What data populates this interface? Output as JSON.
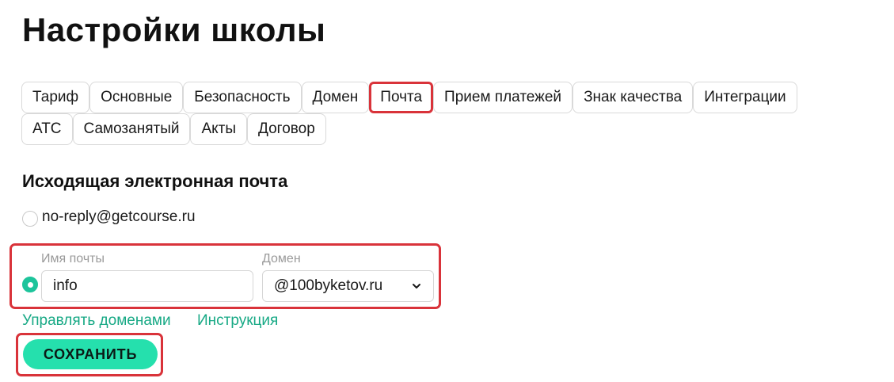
{
  "page": {
    "title": "Настройки школы"
  },
  "tabs": {
    "row1": [
      {
        "label": "Тариф"
      },
      {
        "label": "Основные"
      },
      {
        "label": "Безопасность"
      },
      {
        "label": "Домен"
      },
      {
        "label": "Почта",
        "active": true
      },
      {
        "label": "Прием платежей"
      },
      {
        "label": "Знак качества"
      },
      {
        "label": "Интеграции"
      }
    ],
    "row2": [
      {
        "label": "АТС"
      },
      {
        "label": "Самозанятый"
      },
      {
        "label": "Акты"
      },
      {
        "label": "Договор"
      }
    ]
  },
  "mail": {
    "section_title": "Исходящая электронная почта",
    "default_option": "no-reply@getcourse.ru",
    "name_label": "Имя почты",
    "name_value": "info",
    "domain_label": "Домен",
    "domain_value": "@100byketov.ru",
    "manage_domains_link": "Управлять доменами",
    "instruction_link": "Инструкция",
    "save_label": "СОХРАНИТЬ"
  },
  "colors": {
    "accent": "#25e0ad",
    "link": "#17a985",
    "highlight": "#d9333a"
  }
}
